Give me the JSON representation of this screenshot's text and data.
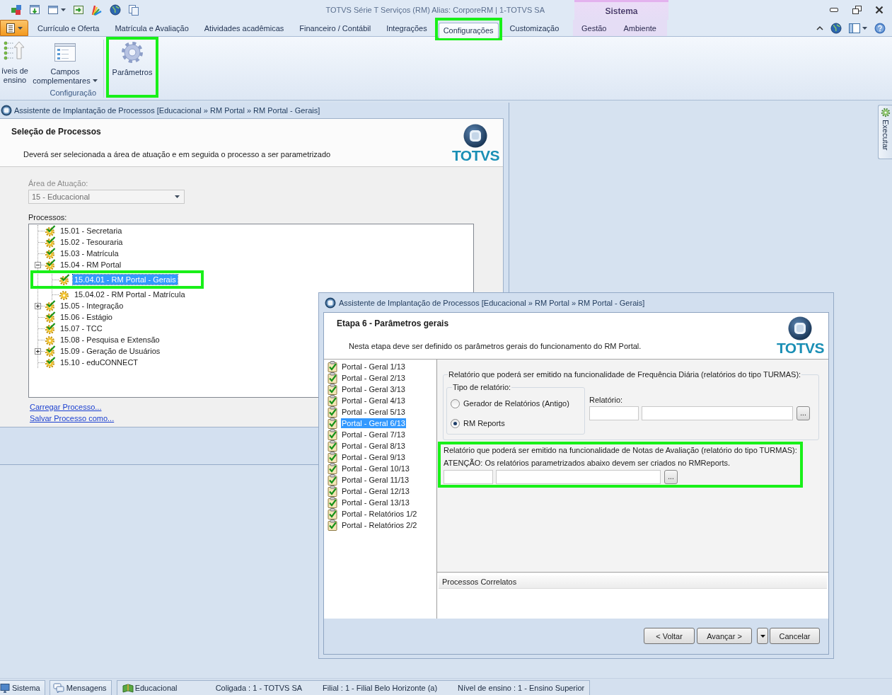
{
  "window": {
    "title": "TOTVS Série T Serviços (RM) Alias: CorporeRM | 1-TOTVS SA",
    "context_label": "Sistema"
  },
  "ribbon": {
    "tabs": [
      {
        "label": "Currículo e Oferta",
        "selected": false,
        "context": false,
        "highlighted": false
      },
      {
        "label": "Matrícula e Avaliação",
        "selected": false,
        "context": false,
        "highlighted": false
      },
      {
        "label": "Atividades acadêmicas",
        "selected": false,
        "context": false,
        "highlighted": false
      },
      {
        "label": "Financeiro / Contábil",
        "selected": false,
        "context": false,
        "highlighted": false
      },
      {
        "label": "Integrações",
        "selected": false,
        "context": false,
        "highlighted": false
      },
      {
        "label": "Configurações",
        "selected": true,
        "context": false,
        "highlighted": true
      },
      {
        "label": "Customização",
        "selected": false,
        "context": false,
        "highlighted": false
      },
      {
        "label": "Gestão",
        "selected": false,
        "context": true,
        "highlighted": false
      },
      {
        "label": "Ambiente",
        "selected": false,
        "context": true,
        "highlighted": false
      }
    ],
    "groups": [
      {
        "label": "Configuração",
        "buttons": [
          {
            "kind": "levels",
            "label": "íveis de ensino",
            "menu": false,
            "highlighted": false
          },
          {
            "kind": "fields",
            "label": "Campos complementares",
            "menu": true,
            "highlighted": false
          }
        ]
      },
      {
        "buttons": [
          {
            "kind": "settings",
            "label": "Parâmetros",
            "menu": false,
            "highlighted": true
          }
        ]
      }
    ]
  },
  "process_window": {
    "title": "Assistente de Implantação de Processos [Educacional » RM Portal » RM Portal - Gerais]",
    "heading": "Seleção de Processos",
    "description": "Deverá ser selecionada a área de atuação e em seguida o processo a ser parametrizado",
    "logo": "TOTVS",
    "area": {
      "label": "Área de Atuação:",
      "value": "15 - Educacional",
      "disabled": true
    },
    "processes_label": "Processos:",
    "tree": [
      {
        "label": "15.01 - Secretaria",
        "done": true,
        "selected": false,
        "highlighted": false
      },
      {
        "label": "15.02 - Tesouraria",
        "done": true,
        "selected": false,
        "highlighted": false
      },
      {
        "label": "15.03 - Matrícula",
        "done": true,
        "selected": false,
        "highlighted": false
      },
      {
        "label": "15.04 - RM Portal",
        "done": true,
        "selected": false,
        "highlighted": false,
        "expanded": true,
        "children": [
          {
            "label": "15.04.01 - RM Portal - Gerais",
            "done": true,
            "selected": true,
            "highlighted": true
          },
          {
            "label": "15.04.02 - RM Portal - Matrícula",
            "done": false,
            "selected": false,
            "highlighted": false
          }
        ]
      },
      {
        "label": "15.05 - Integração",
        "done": true,
        "selected": false,
        "highlighted": false,
        "expanded": false
      },
      {
        "label": "15.06 - Estágio",
        "done": true,
        "selected": false,
        "highlighted": false
      },
      {
        "label": "15.07 - TCC",
        "done": true,
        "selected": false,
        "highlighted": false
      },
      {
        "label": "15.08 - Pesquisa e Extensão",
        "done": false,
        "selected": false,
        "highlighted": false
      },
      {
        "label": "15.09 - Geração de Usuários",
        "done": true,
        "selected": false,
        "highlighted": false,
        "expanded": false
      },
      {
        "label": "15.10 - eduCONNECT",
        "done": true,
        "selected": false,
        "highlighted": false
      }
    ],
    "links": [
      "Carregar Processo...",
      "Salvar Processo como..."
    ]
  },
  "side_tab": {
    "label": "Executar"
  },
  "dialog": {
    "title": "Assistente de Implantação de Processos [Educacional » RM Portal » RM Portal - Gerais]",
    "heading": "Etapa 6 - Parâmetros gerais",
    "description": "Nesta etapa deve ser definido os parâmetros gerais do funcionamento do RM Portal.",
    "logo": "TOTVS",
    "steps": [
      {
        "label": "Portal - Geral 1/13",
        "selected": false
      },
      {
        "label": "Portal - Geral 2/13",
        "selected": false
      },
      {
        "label": "Portal - Geral 3/13",
        "selected": false
      },
      {
        "label": "Portal - Geral 4/13",
        "selected": false
      },
      {
        "label": "Portal - Geral 5/13",
        "selected": false
      },
      {
        "label": "Portal - Geral 6/13",
        "selected": true
      },
      {
        "label": "Portal - Geral 7/13",
        "selected": false
      },
      {
        "label": "Portal - Geral 8/13",
        "selected": false
      },
      {
        "label": "Portal - Geral 9/13",
        "selected": false
      },
      {
        "label": "Portal - Geral 10/13",
        "selected": false
      },
      {
        "label": "Portal - Geral 11/13",
        "selected": false
      },
      {
        "label": "Portal - Geral 12/13",
        "selected": false
      },
      {
        "label": "Portal - Geral 13/13",
        "selected": false
      },
      {
        "label": "Portal - Relatórios 1/2",
        "selected": false
      },
      {
        "label": "Portal - Relatórios 2/2",
        "selected": false
      }
    ],
    "frequency_group": {
      "legend": "Relatório que poderá ser emitido na funcionalidade de Frequência Diária (relatórios do tipo TURMAS):",
      "report_type": {
        "legend": "Tipo de relatório:",
        "options": [
          {
            "label": "Gerador de Relatórios (Antigo)",
            "selected": false
          },
          {
            "label": "RM Reports",
            "selected": true
          }
        ]
      },
      "report_label": "Relatório:",
      "browse_button": "..."
    },
    "grades_section": {
      "highlighted": true,
      "text": "Relatório que poderá ser emitido na funcionalidade de Notas de Avaliação (relatório do tipo TURMAS):",
      "warning": "ATENÇÃO: Os relatórios parametrizados abaixo devem ser criados no RMReports.",
      "browse_button": "..."
    },
    "related_panel": {
      "title": "Processos Correlatos"
    },
    "buttons": [
      {
        "kind": "button",
        "label": "< Voltar"
      },
      {
        "kind": "button",
        "label": "Avançar >"
      },
      {
        "kind": "menu"
      },
      {
        "kind": "button",
        "label": "Cancelar"
      }
    ]
  },
  "status_bar": {
    "tabs": [
      {
        "kind": "system",
        "label": "Sistema"
      },
      {
        "kind": "messages",
        "label": "Mensagens"
      }
    ],
    "module": "Educacional",
    "fields": [
      "Coligada : 1 - TOTVS SA",
      "Filial : 1 - Filial Belo Horizonte (a)",
      "Nível de ensino : 1 - Ensino Superior"
    ]
  }
}
